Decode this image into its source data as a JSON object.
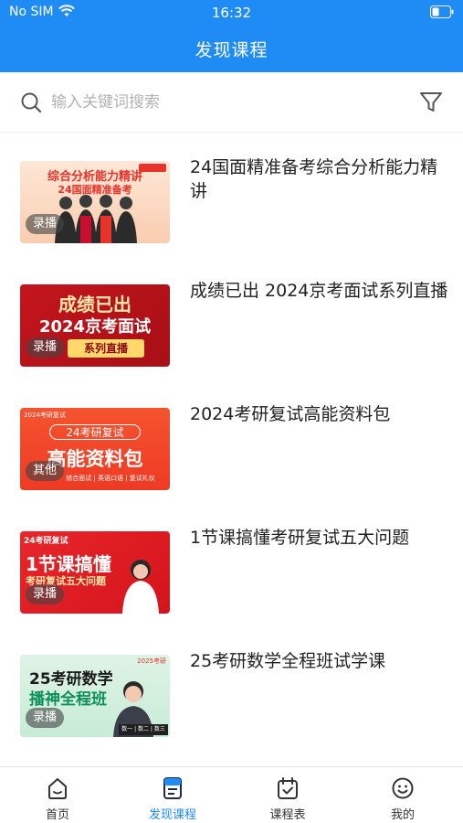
{
  "status_bar": {
    "carrier": "No SIM",
    "time": "16:32"
  },
  "header": {
    "title": "发现课程"
  },
  "search": {
    "placeholder": "输入关键词搜索",
    "value": ""
  },
  "courses": [
    {
      "title": "24国面精准备考综合分析能力精讲",
      "tag": "录播",
      "thumb": {
        "line1": "综合分析能力精讲",
        "line2": "24国面精准备考"
      }
    },
    {
      "title": "成绩已出 2024京考面试系列直播",
      "tag": "录播",
      "thumb": {
        "line1": "成绩已出",
        "line2": "2024京考面试",
        "line3": "系列直播"
      }
    },
    {
      "title": "2024考研复试高能资料包",
      "tag": "其他",
      "thumb": {
        "badge": "2024考研复试",
        "line1": "24考研复试",
        "line2": "高能资料包",
        "line3": "综合面试 | 英语口语 | 复试礼仪"
      }
    },
    {
      "title": "1节课搞懂考研复试五大问题",
      "tag": "录播",
      "thumb": {
        "badge": "24考研复试",
        "line1": "1节课搞懂",
        "line2": "考研复试五大问题"
      }
    },
    {
      "title": "25考研数学全程班试学课",
      "tag": "录播",
      "thumb": {
        "badge": "2025考研",
        "line1": "25考研数学",
        "line2": "播神全程班",
        "line3": "数一 | 数二 | 数三"
      }
    }
  ],
  "tabbar": [
    {
      "label": "首页",
      "icon": "home-icon",
      "active": false
    },
    {
      "label": "发现课程",
      "icon": "discover-icon",
      "active": true
    },
    {
      "label": "课程表",
      "icon": "calendar-icon",
      "active": false
    },
    {
      "label": "我的",
      "icon": "profile-icon",
      "active": false
    }
  ],
  "colors": {
    "primary": "#1f8cf5",
    "thumb_red": "#e8332a",
    "thumb_orange": "#f26b3a"
  }
}
